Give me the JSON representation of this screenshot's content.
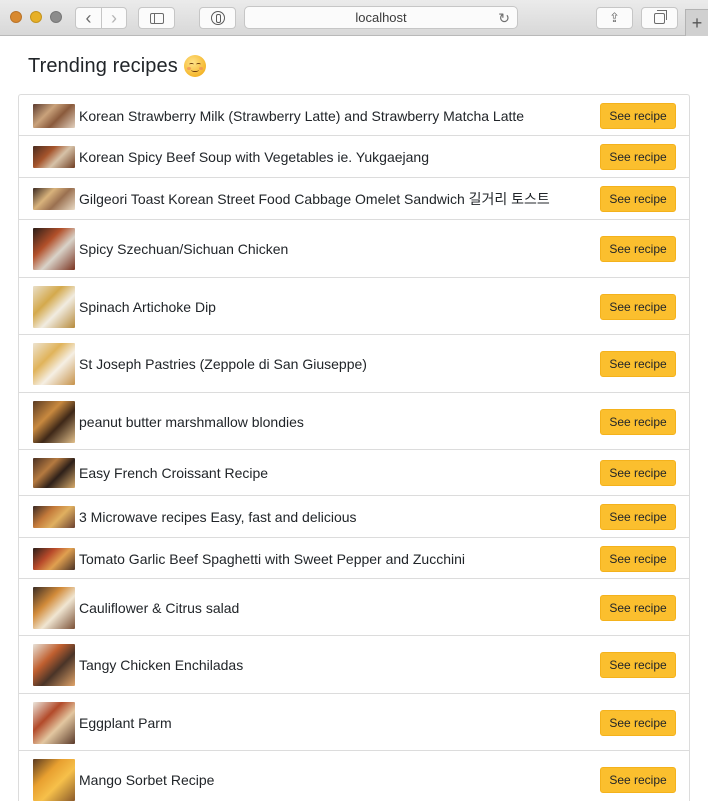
{
  "browser": {
    "url": "localhost",
    "back_glyph": "‹",
    "forward_glyph": "›",
    "reload_glyph": "↻",
    "share_glyph": "⇪",
    "newtab_glyph": "+"
  },
  "page": {
    "title": "Trending recipes",
    "title_emoji": "yum-face-icon"
  },
  "colors": {
    "button_bg": "#fbbf2e",
    "border": "#dcdcdc",
    "text": "#212529"
  },
  "recipes": [
    {
      "name": "Korean Strawberry Milk (Strawberry Latte) and Strawberry Matcha Latte",
      "button": "See recipe",
      "thumb": [
        "#5b3a2e",
        "#c9a27b",
        "#8a5a3c",
        "#e3d2c0"
      ]
    },
    {
      "name": "Korean Spicy Beef Soup with Vegetables ie. Yukgaejang",
      "button": "See recipe",
      "thumb": [
        "#4a2c1f",
        "#a5542c",
        "#d6c2a8",
        "#6f3d22"
      ]
    },
    {
      "name": "Gilgeori Toast Korean Street Food Cabbage Omelet Sandwich 길거리 토스트",
      "button": "See recipe",
      "thumb": [
        "#3b2a22",
        "#d8b27c",
        "#9a7050",
        "#eadcc6"
      ]
    },
    {
      "name": "Spicy Szechuan/Sichuan Chicken",
      "button": "See recipe",
      "thumb": [
        "#2a1d18",
        "#b2502a",
        "#d9d3c9",
        "#7a3320"
      ]
    },
    {
      "name": "Spinach Artichoke Dip",
      "button": "See recipe",
      "thumb": [
        "#e9dfc9",
        "#d4a94c",
        "#f1ece1",
        "#b68a3b"
      ]
    },
    {
      "name": "St Joseph Pastries (Zeppole di San Giuseppe)",
      "button": "See recipe",
      "thumb": [
        "#ede3d0",
        "#e0b35a",
        "#f5efe4",
        "#c6924a"
      ]
    },
    {
      "name": "peanut butter marshmallow blondies",
      "button": "See recipe",
      "thumb": [
        "#5a3a22",
        "#c8893f",
        "#3e2818",
        "#e2c08c"
      ]
    },
    {
      "name": "Easy French Croissant Recipe",
      "button": "See recipe",
      "thumb": [
        "#4a3022",
        "#b57a40",
        "#2e2019",
        "#d7ab6c"
      ]
    },
    {
      "name": "3 Microwave recipes Easy, fast and delicious",
      "button": "See recipe",
      "thumb": [
        "#3a2a24",
        "#c47a3a",
        "#e0b060",
        "#6a4030"
      ]
    },
    {
      "name": "Tomato Garlic Beef Spaghetti with Sweet Pepper and Zucchini",
      "button": "See recipe",
      "thumb": [
        "#2a1e1a",
        "#b84a2a",
        "#e0a050",
        "#4a3226"
      ]
    },
    {
      "name": "Cauliflower & Citrus salad",
      "button": "See recipe",
      "thumb": [
        "#3a2c24",
        "#d28b3a",
        "#f0e6d2",
        "#7a5036"
      ]
    },
    {
      "name": "Tangy Chicken Enchiladas",
      "button": "See recipe",
      "thumb": [
        "#e8e2d8",
        "#c06030",
        "#4a3428",
        "#e0a46a"
      ]
    },
    {
      "name": "Eggplant Parm",
      "button": "See recipe",
      "thumb": [
        "#ece6dc",
        "#b24a2a",
        "#e3c7a0",
        "#5a3a2a"
      ]
    },
    {
      "name": "Mango Sorbet Recipe",
      "button": "See recipe",
      "thumb": [
        "#5a3a20",
        "#e8a030",
        "#f6c04a",
        "#8a5a2a"
      ]
    }
  ]
}
